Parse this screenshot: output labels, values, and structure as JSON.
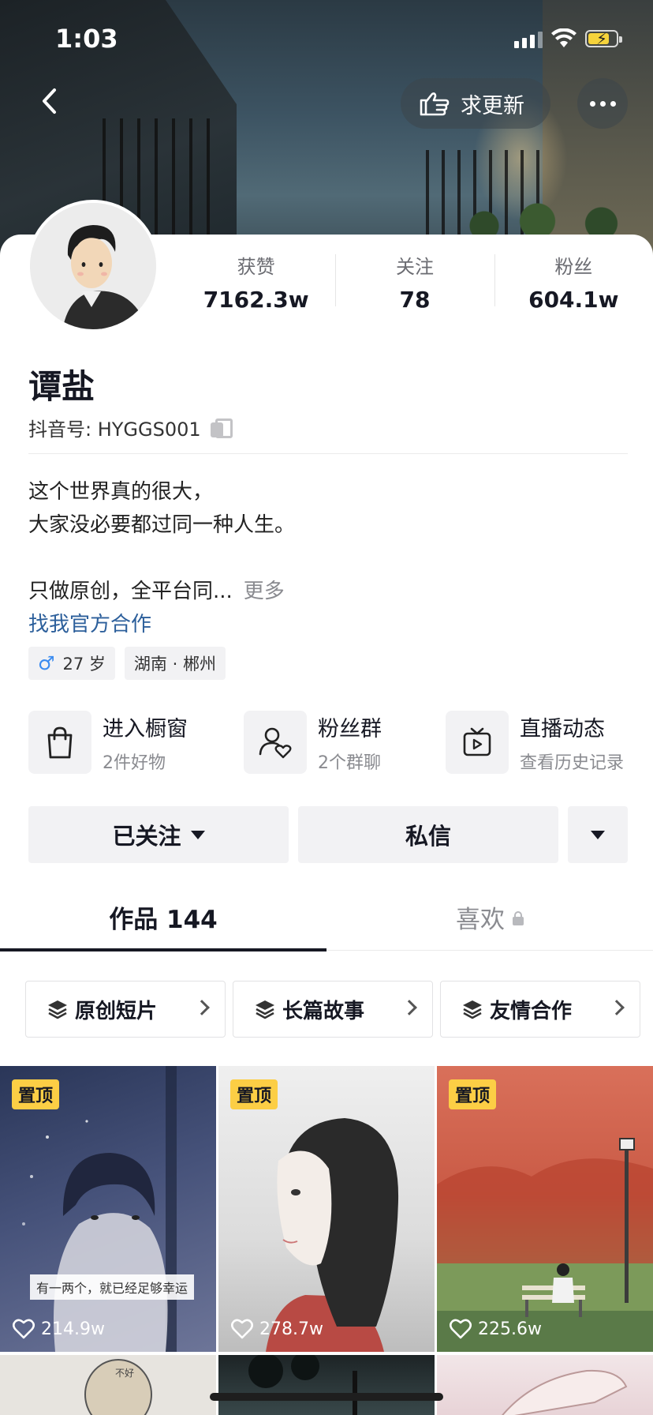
{
  "status_bar": {
    "time": "1:03",
    "battery_level": 0.75
  },
  "nav": {
    "update_label": "求更新"
  },
  "profile": {
    "name": "谭盐",
    "douyin_id_label": "抖音号: HYGGS001",
    "stats": [
      {
        "label": "获赞",
        "value": "7162.3w"
      },
      {
        "label": "关注",
        "value": "78"
      },
      {
        "label": "粉丝",
        "value": "604.1w"
      }
    ],
    "bio_lines": [
      "这个世界真的很大，",
      "大家没必要都过同一种人生。",
      "",
      "只做原创，全平台同..."
    ],
    "bio_more": "更多",
    "bio_link": "找我官方合作",
    "tags": {
      "age": "27 岁",
      "location": "湖南 · 郴州"
    }
  },
  "services": [
    {
      "title": "进入橱窗",
      "subtitle": "2件好物",
      "icon": "shopping-bag-icon"
    },
    {
      "title": "粉丝群",
      "subtitle": "2个群聊",
      "icon": "fan-group-icon"
    },
    {
      "title": "直播动态",
      "subtitle": "查看历史记录",
      "icon": "tv-play-icon"
    }
  ],
  "actions": {
    "follow_label": "已关注",
    "message_label": "私信"
  },
  "tabs": [
    {
      "label": "作品 144",
      "active": true
    },
    {
      "label": "喜欢",
      "active": false,
      "locked": true
    }
  ],
  "collections": [
    "原创短片",
    "长篇故事",
    "友情合作"
  ],
  "videos": [
    {
      "pinned_label": "置顶",
      "likes": "214.9w",
      "caption": "有一两个，就已经足够幸运"
    },
    {
      "pinned_label": "置顶",
      "likes": "278.7w"
    },
    {
      "pinned_label": "置顶",
      "likes": "225.6w"
    }
  ],
  "second_row": {
    "bubble_text": "不好"
  },
  "colors": {
    "pin": "#fcce45",
    "link": "#2c5f9b",
    "accent_text": "#161823"
  }
}
